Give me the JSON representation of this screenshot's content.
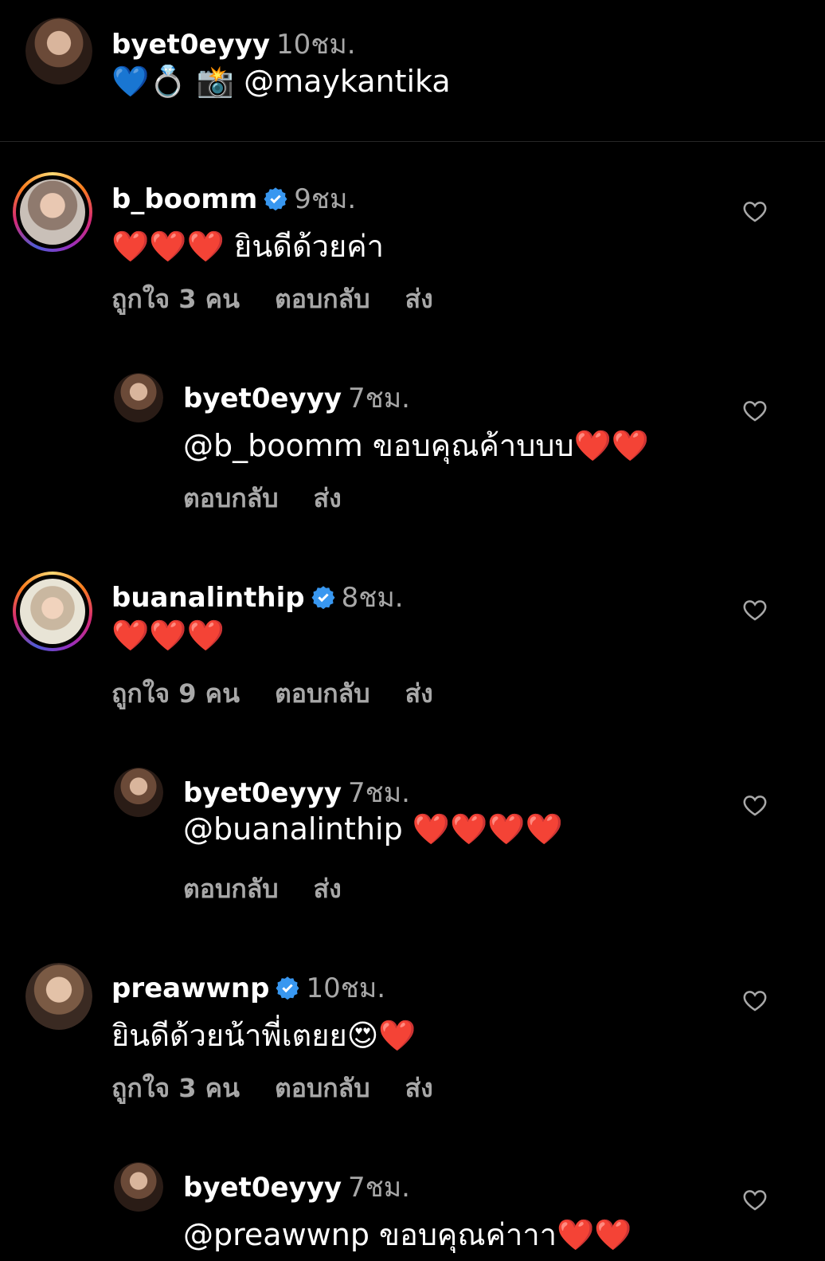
{
  "caption": {
    "username": "byet0eyyy",
    "time": "10ชม.",
    "text": "💙💍 📸 @maykantika"
  },
  "comments": [
    {
      "username": "b_boomm",
      "verified": true,
      "time": "9ชม.",
      "text": "❤️❤️❤️ ยินดีด้วยค่า",
      "likes": "ถูกใจ 3 คน",
      "reply_label": "ตอบกลับ",
      "send_label": "ส่ง"
    },
    {
      "username": "byet0eyyy",
      "verified": false,
      "time": "7ชม.",
      "text": "@b_boomm ขอบคุณค้าบบบ❤️❤️",
      "reply_label": "ตอบกลับ",
      "send_label": "ส่ง"
    },
    {
      "username": "buanalinthip",
      "verified": true,
      "time": "8ชม.",
      "text": "❤️❤️❤️",
      "likes": "ถูกใจ 9 คน",
      "reply_label": "ตอบกลับ",
      "send_label": "ส่ง"
    },
    {
      "username": "byet0eyyy",
      "verified": false,
      "time": "7ชม.",
      "text": "@buanalinthip ❤️❤️❤️❤️",
      "reply_label": "ตอบกลับ",
      "send_label": "ส่ง"
    },
    {
      "username": "preawwnp",
      "verified": true,
      "time": "10ชม.",
      "text": "ยินดีด้วยน้าพี่เตยย😍❤️",
      "likes": "ถูกใจ 3 คน",
      "reply_label": "ตอบกลับ",
      "send_label": "ส่ง"
    },
    {
      "username": "byet0eyyy",
      "verified": false,
      "time": "7ชม.",
      "text": "@preawwnp ขอบคุณค่าาา❤️❤️"
    }
  ],
  "colors": {
    "background": "#000000",
    "secondary_text": "#a8a8a8",
    "verified_blue": "#3897f0",
    "divider": "#262626"
  },
  "icons": {
    "like": "heart-outline-icon",
    "verified": "verified-badge-icon"
  }
}
